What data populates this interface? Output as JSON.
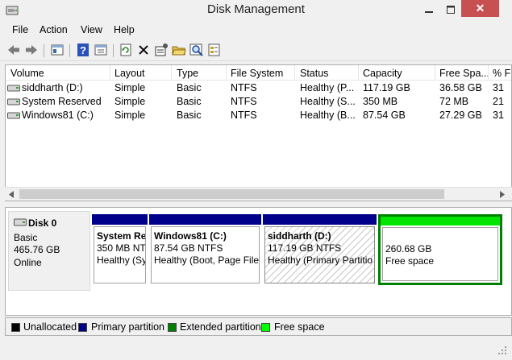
{
  "window": {
    "title": "Disk Management",
    "close_label": "✕"
  },
  "menu": {
    "items": [
      "File",
      "Action",
      "View",
      "Help"
    ]
  },
  "toolbar": {
    "icons": [
      "back-arrow-icon",
      "forward-arrow-icon",
      "console-tree-icon",
      "help-icon",
      "properties-icon",
      "refresh-icon",
      "delete-icon",
      "settings-icon",
      "open-folder-icon",
      "find-icon",
      "export-list-icon"
    ]
  },
  "volumes": {
    "columns": [
      "Volume",
      "Layout",
      "Type",
      "File System",
      "Status",
      "Capacity",
      "Free Spa...",
      "% F"
    ],
    "rows": [
      {
        "volume": "siddharth (D:)",
        "layout": "Simple",
        "type": "Basic",
        "fs": "NTFS",
        "status": "Healthy (P...",
        "capacity": "117.19 GB",
        "free": "36.58 GB",
        "pct": "31"
      },
      {
        "volume": "System Reserved",
        "layout": "Simple",
        "type": "Basic",
        "fs": "NTFS",
        "status": "Healthy (S...",
        "capacity": "350 MB",
        "free": "72 MB",
        "pct": "21"
      },
      {
        "volume": "Windows81 (C:)",
        "layout": "Simple",
        "type": "Basic",
        "fs": "NTFS",
        "status": "Healthy (B...",
        "capacity": "87.54 GB",
        "free": "27.29 GB",
        "pct": "31"
      }
    ]
  },
  "disk": {
    "name": "Disk 0",
    "type": "Basic",
    "size": "465.76 GB",
    "state": "Online",
    "partitions": [
      {
        "name": "System Re",
        "size": "350 MB NTFS",
        "status": "Healthy (Sy",
        "kind": "primary"
      },
      {
        "name": "Windows81  (C:)",
        "size": "87.54 GB NTFS",
        "status": "Healthy (Boot, Page File",
        "kind": "primary"
      },
      {
        "name": "siddharth  (D:)",
        "size": "117.19 GB NTFS",
        "status": "Healthy (Primary Partitio",
        "kind": "primary-selected"
      },
      {
        "name": "",
        "size": "260.68 GB",
        "status": "Free space",
        "kind": "free"
      }
    ]
  },
  "legend": [
    {
      "label": "Unallocated",
      "color": "#000000"
    },
    {
      "label": "Primary partition",
      "color": "#00008b"
    },
    {
      "label": "Extended partition",
      "color": "#008000"
    },
    {
      "label": "Free space",
      "color": "#00ff00"
    }
  ],
  "colors": {
    "primary": "#00008b",
    "free": "#00e600",
    "extended_border": "#008000",
    "close": "#c75050"
  }
}
